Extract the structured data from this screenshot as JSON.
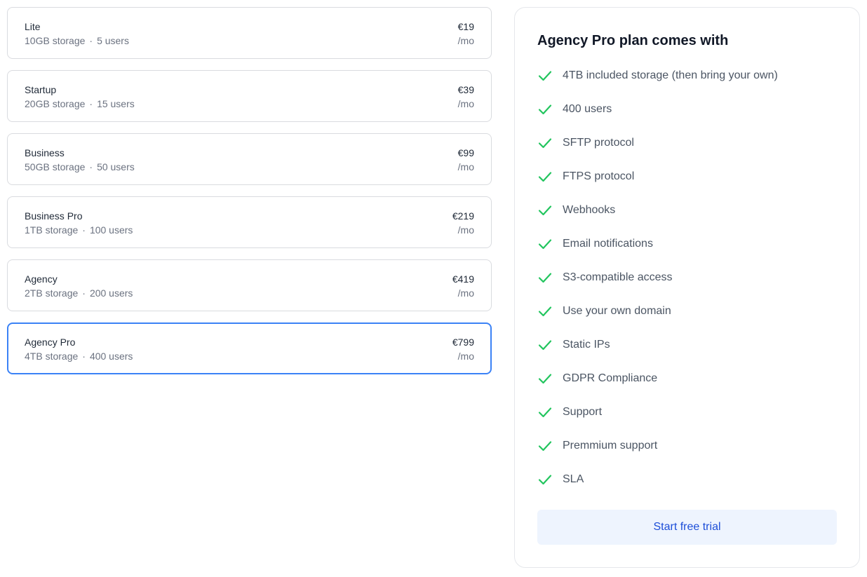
{
  "plans": [
    {
      "name": "Lite",
      "storage": "10GB storage",
      "users": "5 users",
      "price": "€19",
      "period": "/mo",
      "selected": false
    },
    {
      "name": "Startup",
      "storage": "20GB storage",
      "users": "15 users",
      "price": "€39",
      "period": "/mo",
      "selected": false
    },
    {
      "name": "Business",
      "storage": "50GB storage",
      "users": "50 users",
      "price": "€99",
      "period": "/mo",
      "selected": false
    },
    {
      "name": "Business Pro",
      "storage": "1TB storage",
      "users": "100 users",
      "price": "€219",
      "period": "/mo",
      "selected": false
    },
    {
      "name": "Agency",
      "storage": "2TB storage",
      "users": "200 users",
      "price": "€419",
      "period": "/mo",
      "selected": false
    },
    {
      "name": "Agency Pro",
      "storage": "4TB storage",
      "users": "400 users",
      "price": "€799",
      "period": "/mo",
      "selected": true
    }
  ],
  "separator": "·",
  "features": {
    "title": "Agency Pro plan comes with",
    "items": [
      "4TB included storage (then bring your own)",
      "400 users",
      "SFTP protocol",
      "FTPS protocol",
      "Webhooks",
      "Email notifications",
      "S3-compatible access",
      "Use your own domain",
      "Static IPs",
      "GDPR Compliance",
      "Support",
      "Premmium support",
      "SLA"
    ],
    "check_icon": "check-icon",
    "cta_label": "Start free trial"
  },
  "colors": {
    "accent": "#3b82f6",
    "check": "#22c55e",
    "cta_bg": "#eef4fe",
    "cta_text": "#1d4ed8"
  }
}
